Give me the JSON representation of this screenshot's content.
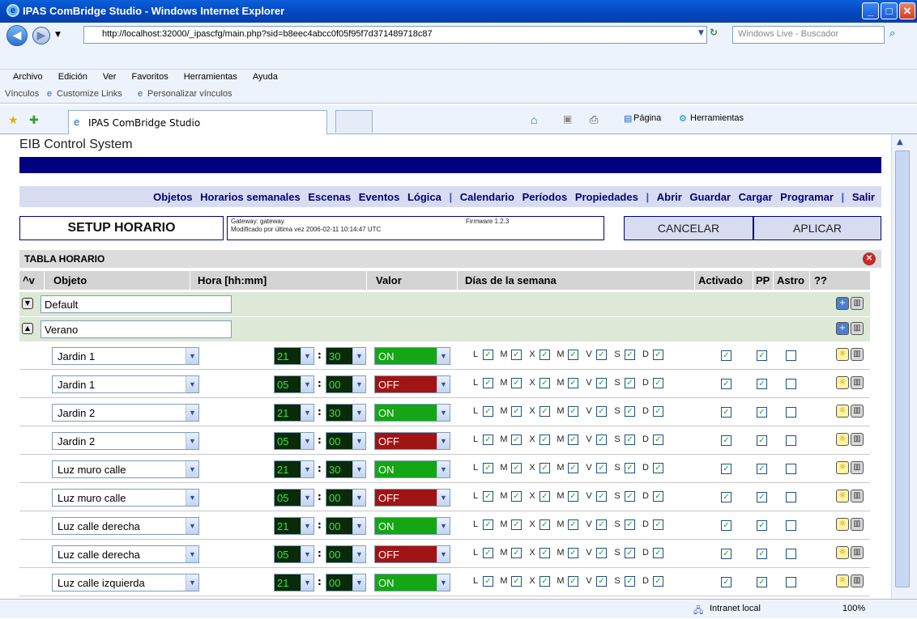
{
  "window": {
    "title": "IPAS ComBridge Studio - Windows Internet Explorer"
  },
  "browser": {
    "url": "http://localhost:32000/_ipascfg/main.php?sid=b8eec4abcc0f05f95f7d371489718c87",
    "search_placeholder": "Windows Live - Buscador",
    "menu": [
      "Archivo",
      "Edición",
      "Ver",
      "Favoritos",
      "Herramientas",
      "Ayuda"
    ],
    "links_label": "Vínculos",
    "links": [
      "Customize Links",
      "Personalizar vínculos"
    ],
    "tab_title": "IPAS ComBridge Studio",
    "tools": {
      "pagina": "Página",
      "herramientas": "Herramientas"
    },
    "status": {
      "zone": "Intranet local",
      "zoom": "100%"
    }
  },
  "app": {
    "title": "EIB Control System",
    "nav": [
      "Objetos",
      "Horarios semanales",
      "Escenas",
      "Eventos",
      "Lógica",
      "|",
      "Calendario",
      "Períodos",
      "Propiedades",
      "|",
      "Abrir",
      "Guardar",
      "Cargar",
      "Programar",
      "|",
      "Salir"
    ],
    "setup_title": "SETUP HORARIO",
    "gateway": "Gateway: gateway",
    "modified": "Modificado por última vez 2006-02-11 10:14:47 UTC",
    "firmware": "Firmware 1.2.3",
    "cancel_label": "CANCELAR",
    "apply_label": "APLICAR"
  },
  "table": {
    "title": "TABLA HORARIO",
    "columns": {
      "sort": "^v",
      "objeto": "Objeto",
      "hora": "Hora [hh:mm]",
      "valor": "Valor",
      "dias": "Días de la semana",
      "activado": "Activado",
      "pp": "PP",
      "astro": "Astro",
      "q": "??"
    },
    "groups": [
      "Default",
      "Verano"
    ],
    "day_letters": [
      "L",
      "M",
      "X",
      "M",
      "V",
      "S",
      "D"
    ],
    "rows": [
      {
        "objeto": "Jardin 1",
        "hh": "21",
        "mm": "30",
        "valor": "ON"
      },
      {
        "objeto": "Jardin 1",
        "hh": "05",
        "mm": "00",
        "valor": "OFF"
      },
      {
        "objeto": "Jardin 2",
        "hh": "21",
        "mm": "30",
        "valor": "ON"
      },
      {
        "objeto": "Jardin 2",
        "hh": "05",
        "mm": "00",
        "valor": "OFF"
      },
      {
        "objeto": "Luz muro calle",
        "hh": "21",
        "mm": "30",
        "valor": "ON"
      },
      {
        "objeto": "Luz muro calle",
        "hh": "05",
        "mm": "00",
        "valor": "OFF"
      },
      {
        "objeto": "Luz calle derecha",
        "hh": "21",
        "mm": "00",
        "valor": "ON"
      },
      {
        "objeto": "Luz calle derecha",
        "hh": "05",
        "mm": "00",
        "valor": "OFF"
      },
      {
        "objeto": "Luz calle izquierda",
        "hh": "21",
        "mm": "00",
        "valor": "ON"
      }
    ]
  }
}
